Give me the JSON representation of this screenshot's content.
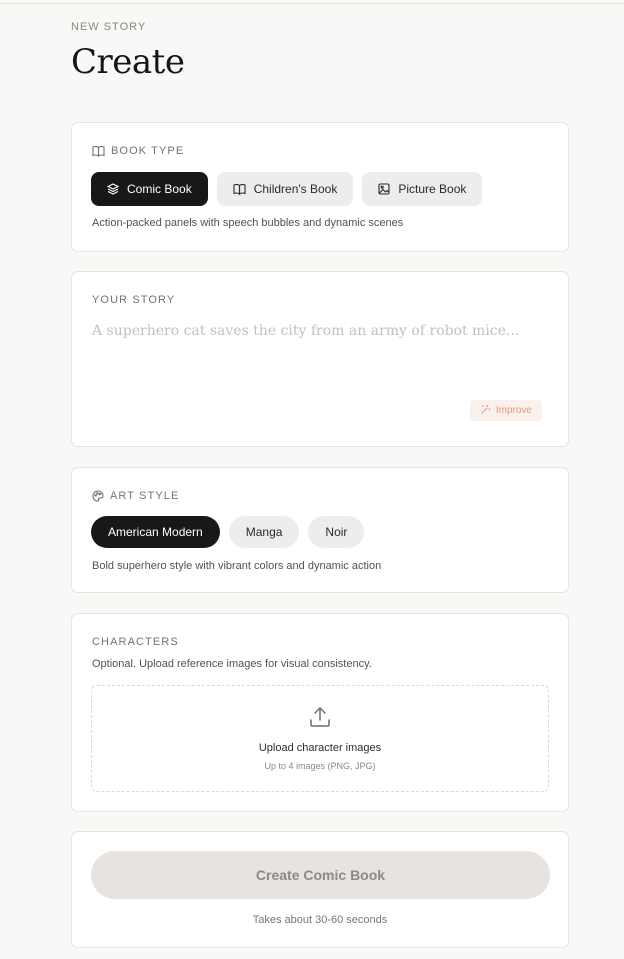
{
  "header": {
    "eyebrow": "NEW STORY",
    "title": "Create"
  },
  "book_type": {
    "label": "BOOK TYPE",
    "icon": "open-book-icon",
    "options": [
      {
        "label": "Comic Book",
        "icon": "layers-icon",
        "selected": true
      },
      {
        "label": "Children's Book",
        "icon": "book-open-icon",
        "selected": false
      },
      {
        "label": "Picture Book",
        "icon": "image-icon",
        "selected": false
      }
    ],
    "description": "Action-packed panels with speech bubbles and dynamic scenes"
  },
  "story": {
    "label": "YOUR STORY",
    "placeholder": "A superhero cat saves the city from an army of robot mice...",
    "improve_label": "Improve",
    "improve_icon": "sparkle-wand-icon"
  },
  "art_style": {
    "label": "ART STYLE",
    "icon": "palette-icon",
    "options": [
      {
        "label": "American Modern",
        "selected": true
      },
      {
        "label": "Manga",
        "selected": false
      },
      {
        "label": "Noir",
        "selected": false
      }
    ],
    "description": "Bold superhero style with vibrant colors and dynamic action"
  },
  "characters": {
    "label": "CHARACTERS",
    "description": "Optional. Upload reference images for visual consistency.",
    "upload_title": "Upload character images",
    "upload_hint": "Up to 4 images (PNG, JPG)",
    "upload_icon": "upload-icon"
  },
  "submit": {
    "button_label": "Create Comic Book",
    "hint": "Takes about 30-60 seconds"
  },
  "colors": {
    "background": "#f9f8f6",
    "selected_pill": "#181818",
    "improve_accent": "#e59a7a"
  }
}
